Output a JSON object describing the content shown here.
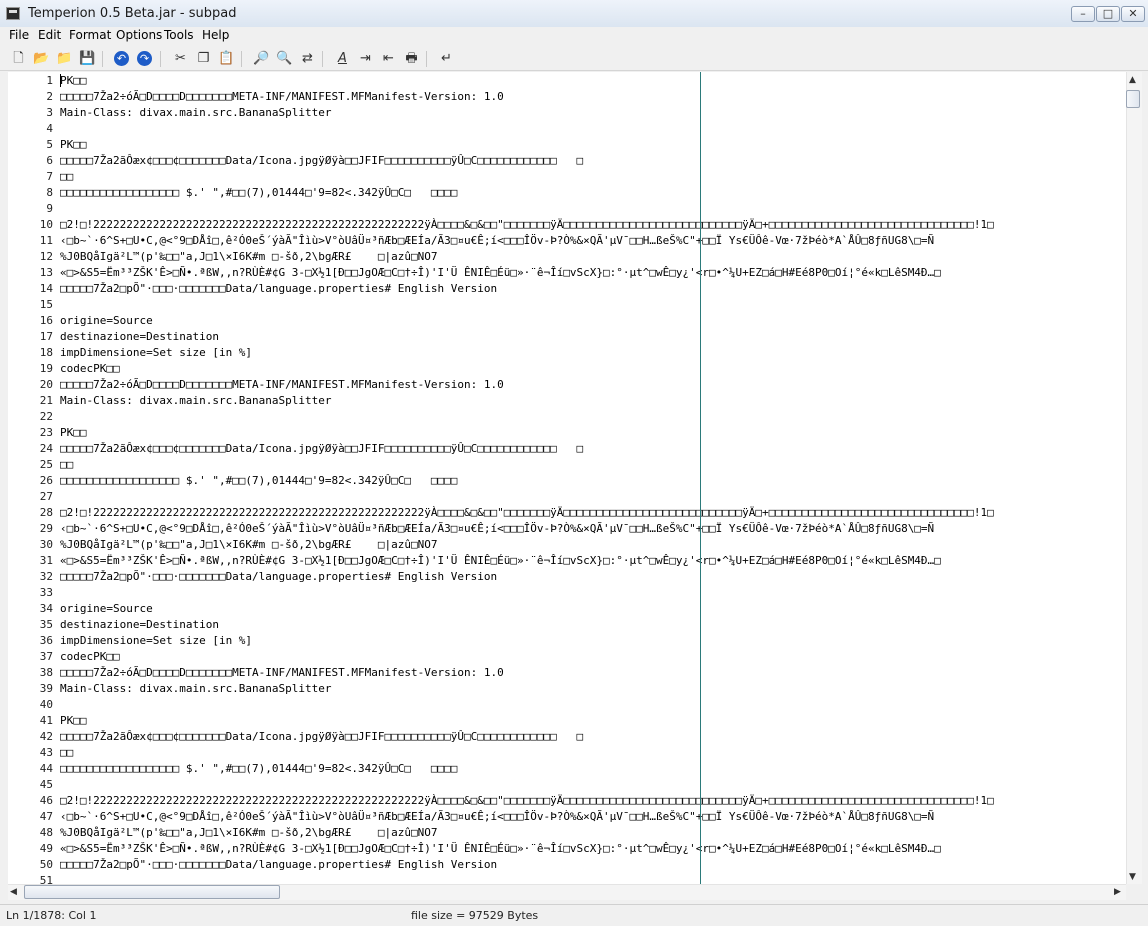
{
  "window": {
    "title": "Temperion 0.5 Beta.jar - subpad",
    "minimize": "–",
    "maximize": "□",
    "close": "✕"
  },
  "menu": [
    {
      "label": "File"
    },
    {
      "label": "Edit"
    },
    {
      "label": "Format"
    },
    {
      "label": "Options"
    },
    {
      "label": "Tools"
    },
    {
      "label": "Help"
    }
  ],
  "toolbar_icons": [
    "new-file-icon",
    "open-folder-icon",
    "open-recent-icon",
    "save-icon",
    "undo-icon",
    "redo-icon",
    "cut-icon",
    "copy-icon",
    "paste-icon",
    "find-icon",
    "find-next-icon",
    "replace-icon",
    "font-icon",
    "indent-icon",
    "outdent-icon",
    "print-icon",
    "wrap-icon"
  ],
  "editor": {
    "lines": [
      {
        "n": "1",
        "t": "PK□□"
      },
      {
        "n": "2",
        "t": "□□□□□7Ža2÷óÃ□D□□□□D□□□□□□□META-INF/MANIFEST.MFManifest-Version: 1.0"
      },
      {
        "n": "3",
        "t": "Main-Class: divax.main.src.BananaSplitter"
      },
      {
        "n": "4",
        "t": ""
      },
      {
        "n": "5",
        "t": "PK□□"
      },
      {
        "n": "6",
        "t": "□□□□□7Ža2ãÔæx¢□□□¢□□□□□□□Data/Icona.jpgÿØÿà□□JFIF□□□□□□□□□□ÿÛ□C□□□□□□□□□□□□   □"
      },
      {
        "n": "7",
        "t": "□□"
      },
      {
        "n": "8",
        "t": "□□□□□□□□□□□□□□□□□□ $.' \",#□□(7),01444□'9=82<.342ÿÛ□C□   □□□□"
      },
      {
        "n": "9",
        "t": ""
      },
      {
        "n": "10",
        "t": "□2!□!22222222222222222222222222222222222222222222222222ÿÀ□□□□&□&□□\"□□□□□□□ÿÄ□□□□□□□□□□□□□□□□□□□□□□□□□□□ÿÄ□+□□□□□□□□□□□□□□□□□□□□□□□□□□□□□□□!1□"
      },
      {
        "n": "11",
        "t": "‹□b~`·6^S+□U•C,@<°9□DÅî□,ê²Ó0eŠ´ýàÃ\"Îìù>V°òUâÜ¤³ñÆb□ÆEÍa/Ã3□¤u€Ê;í<□□□ÎÖv-Þ?Ò%&×QÃ'µV¯□□H…ßeŠ%C\"+□□Ï Ys€ÜÔê-Vœ·7žÞéò*A`ÅÛ□8ƒñUG8\\□=Ñ"
      },
      {
        "n": "12",
        "t": "%J0BQåIgä²L™(p'‰□□\"a,J□1\\×I6K#m □-šð,2\\bgÆR£    □|azû□NO7"
      },
      {
        "n": "13",
        "t": "«□>&S5=Ëm³³ZŠK'Ê>□Ñ•.ªßW,,n?RÙÈ#¢G 3-□X½1[Ð□□JgOÆ□C□†÷Î)'I'Ü ÊNIÊ□Éü□»·¨ê¬Îí□vScX}□:°·µt^□wÊ□y¿'<r□•^¼U+EZ□á□H#Eé8P0□Oí¦°é«k□LêSM4Ð…□"
      },
      {
        "n": "14",
        "t": "□□□□□7Ža2□pÕ\"·□□□·□□□□□□□Data/language.properties# English Version"
      },
      {
        "n": "15",
        "t": ""
      },
      {
        "n": "16",
        "t": "origine=Source"
      },
      {
        "n": "17",
        "t": "destinazione=Destination"
      },
      {
        "n": "18",
        "t": "impDimensione=Set size [in %]"
      },
      {
        "n": "19",
        "t": "codecPK□□"
      },
      {
        "n": "20",
        "t": "□□□□□7Ža2÷óÃ□D□□□□D□□□□□□□META-INF/MANIFEST.MFManifest-Version: 1.0"
      },
      {
        "n": "21",
        "t": "Main-Class: divax.main.src.BananaSplitter"
      },
      {
        "n": "22",
        "t": ""
      },
      {
        "n": "23",
        "t": "PK□□"
      },
      {
        "n": "24",
        "t": "□□□□□7Ža2ãÔæx¢□□□¢□□□□□□□Data/Icona.jpgÿØÿà□□JFIF□□□□□□□□□□ÿÛ□C□□□□□□□□□□□□   □"
      },
      {
        "n": "25",
        "t": "□□"
      },
      {
        "n": "26",
        "t": "□□□□□□□□□□□□□□□□□□ $.' \",#□□(7),01444□'9=82<.342ÿÛ□C□   □□□□"
      },
      {
        "n": "27",
        "t": ""
      },
      {
        "n": "28",
        "t": "□2!□!22222222222222222222222222222222222222222222222222ÿÀ□□□□&□&□□\"□□□□□□□ÿÄ□□□□□□□□□□□□□□□□□□□□□□□□□□□ÿÄ□+□□□□□□□□□□□□□□□□□□□□□□□□□□□□□□□!1□"
      },
      {
        "n": "29",
        "t": "‹□b~`·6^S+□U•C,@<°9□DÅî□,ê²Ó0eŠ´ýàÃ\"Îìù>V°òUâÜ¤³ñÆb□ÆEÍa/Ã3□¤u€Ê;í<□□□ÎÖv-Þ?Ò%&×QÃ'µV¯□□H…ßeŠ%C\"+□□Ï Ys€ÜÔê-Vœ·7žÞéò*A`ÅÛ□8ƒñUG8\\□=Ñ"
      },
      {
        "n": "30",
        "t": "%J0BQåIgä²L™(p'‰□□\"a,J□1\\×I6K#m □-šð,2\\bgÆR£    □|azû□NO7"
      },
      {
        "n": "31",
        "t": "«□>&S5=Ëm³³ZŠK'Ê>□Ñ•.ªßW,,n?RÙÈ#¢G 3-□X½1[Ð□□JgOÆ□C□†÷Î)'I'Ü ÊNIÊ□Éü□»·¨ê¬Îí□vScX}□:°·µt^□wÊ□y¿'<r□•^¼U+EZ□á□H#Eé8P0□Oí¦°é«k□LêSM4Ð…□"
      },
      {
        "n": "32",
        "t": "□□□□□7Ža2□pÕ\"·□□□·□□□□□□□Data/language.properties# English Version"
      },
      {
        "n": "33",
        "t": ""
      },
      {
        "n": "34",
        "t": "origine=Source"
      },
      {
        "n": "35",
        "t": "destinazione=Destination"
      },
      {
        "n": "36",
        "t": "impDimensione=Set size [in %]"
      },
      {
        "n": "37",
        "t": "codecPK□□"
      },
      {
        "n": "38",
        "t": "□□□□□7Ža2÷óÃ□D□□□□D□□□□□□□META-INF/MANIFEST.MFManifest-Version: 1.0"
      },
      {
        "n": "39",
        "t": "Main-Class: divax.main.src.BananaSplitter"
      },
      {
        "n": "40",
        "t": ""
      },
      {
        "n": "41",
        "t": "PK□□"
      },
      {
        "n": "42",
        "t": "□□□□□7Ža2ãÔæx¢□□□¢□□□□□□□Data/Icona.jpgÿØÿà□□JFIF□□□□□□□□□□ÿÛ□C□□□□□□□□□□□□   □"
      },
      {
        "n": "43",
        "t": "□□"
      },
      {
        "n": "44",
        "t": "□□□□□□□□□□□□□□□□□□ $.' \",#□□(7),01444□'9=82<.342ÿÛ□C□   □□□□"
      },
      {
        "n": "45",
        "t": ""
      },
      {
        "n": "46",
        "t": "□2!□!22222222222222222222222222222222222222222222222222ÿÀ□□□□&□&□□\"□□□□□□□ÿÄ□□□□□□□□□□□□□□□□□□□□□□□□□□□ÿÄ□+□□□□□□□□□□□□□□□□□□□□□□□□□□□□□□□!1□"
      },
      {
        "n": "47",
        "t": "‹□b~`·6^S+□U•C,@<°9□DÅî□,ê²Ó0eŠ´ýàÃ\"Îìù>V°òUâÜ¤³ñÆb□ÆEÍa/Ã3□¤u€Ê;í<□□□ÎÖv-Þ?Ò%&×QÃ'µV¯□□H…ßeŠ%C\"+□□Ï Ys€ÜÔê-Vœ·7žÞéò*A`ÅÛ□8ƒñUG8\\□=Ñ"
      },
      {
        "n": "48",
        "t": "%J0BQåIgä²L™(p'‰□□\"a,J□1\\×I6K#m □-šð,2\\bgÆR£    □|azû□NO7"
      },
      {
        "n": "49",
        "t": "«□>&S5=Ëm³³ZŠK'Ê>□Ñ•.ªßW,,n?RÙÈ#¢G 3-□X½1[Ð□□JgOÆ□C□†÷Î)'I'Ü ÊNIÊ□Éü□»·¨ê¬Îí□vScX}□:°·µt^□wÊ□y¿'<r□•^¼U+EZ□á□H#Eé8P0□Oí¦°é«k□LêSM4Ð…□"
      },
      {
        "n": "50",
        "t": "□□□□□7Ža2□pÕ\"·□□□·□□□□□□□Data/language.properties# English Version"
      },
      {
        "n": "51",
        "t": ""
      }
    ]
  },
  "status": {
    "position": "Ln 1/1878: Col 1",
    "file_size": "file size = 97529 Bytes"
  },
  "colors": {
    "margin_line": "#2b7a7a",
    "editor_bg": "#ffffff",
    "chrome_bg": "#f0f0f0"
  }
}
